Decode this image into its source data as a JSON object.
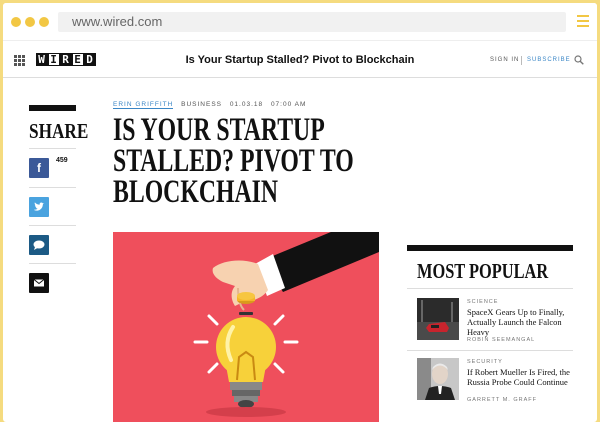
{
  "browser": {
    "url": "www.wired.com"
  },
  "nav": {
    "logo_letters": [
      "W",
      "I",
      "R",
      "E",
      "D"
    ],
    "title": "Is Your Startup Stalled? Pivot to Blockchain",
    "sign_in": "SIGN IN",
    "subscribe": "SUBSCRIBE"
  },
  "share": {
    "label": "SHARE",
    "facebook_count": "459",
    "icons": [
      "facebook-icon",
      "twitter-icon",
      "comment-icon",
      "mail-icon"
    ]
  },
  "article": {
    "author": "ERIN GRIFFITH",
    "section": "BUSINESS",
    "date": "01.03.18",
    "time": "07:00 AM",
    "headline": "IS YOUR STARTUP STALLED? PIVOT TO BLOCKCHAIN"
  },
  "most_popular": {
    "title": "MOST POPULAR",
    "items": [
      {
        "category": "SCIENCE",
        "title": "SpaceX Gears Up to Finally, Actually Launch the Falcon Heavy",
        "author": "ROBIN SEEMANGAL"
      },
      {
        "category": "SECURITY",
        "title": "If Robert Mueller Is Fired, the Russia Probe Could Continue",
        "author": "GARRETT M. GRAFF"
      }
    ]
  },
  "colors": {
    "frame": "#f5db7f",
    "accent_dots": "#f2c744",
    "link_blue": "#3a86c6",
    "hero_bg": "#ef4f5c"
  }
}
